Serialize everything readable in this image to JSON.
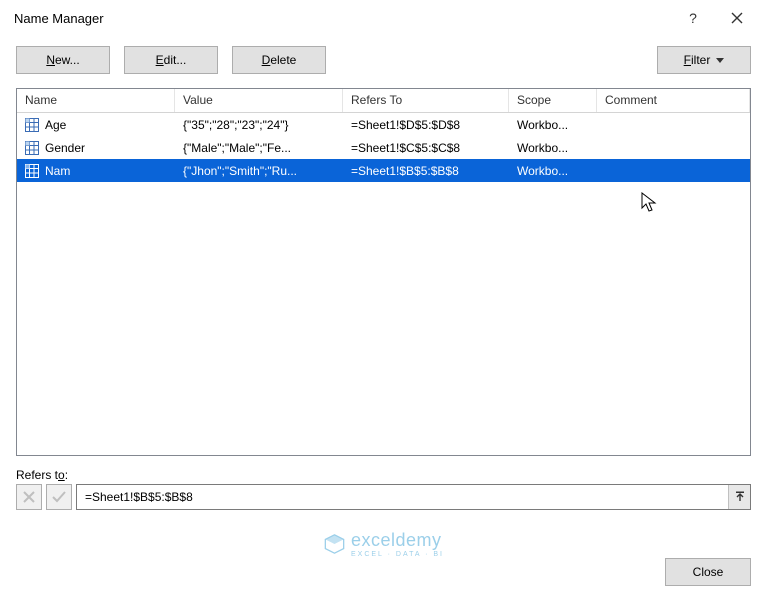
{
  "window": {
    "title": "Name Manager"
  },
  "toolbar": {
    "new": "New...",
    "new_u": "N",
    "edit": "Edit...",
    "edit_u": "E",
    "delete": "Delete",
    "delete_u": "D",
    "filter": "Filter",
    "filter_u": "F"
  },
  "columns": {
    "name": "Name",
    "value": "Value",
    "refers": "Refers To",
    "scope": "Scope",
    "comment": "Comment"
  },
  "rows": [
    {
      "name": "Age",
      "value": "{\"35\";\"28\";\"23\";\"24\"}",
      "refers": "=Sheet1!$D$5:$D$8",
      "scope": "Workbo...",
      "comment": "",
      "selected": false
    },
    {
      "name": "Gender",
      "value": "{\"Male\";\"Male\";\"Fe...",
      "refers": "=Sheet1!$C$5:$C$8",
      "scope": "Workbo...",
      "comment": "",
      "selected": false
    },
    {
      "name": "Nam",
      "value": "{\"Jhon\";\"Smith\";\"Ru...",
      "refers": "=Sheet1!$B$5:$B$8",
      "scope": "Workbo...",
      "comment": "",
      "selected": true
    }
  ],
  "refersTo": {
    "label_prefix": "Refers t",
    "label_u": "o",
    "label_suffix": ":",
    "value": "=Sheet1!$B$5:$B$8"
  },
  "footer": {
    "close": "Close"
  },
  "watermark": {
    "brand": "exceldemy",
    "sub": "EXCEL · DATA · BI"
  }
}
